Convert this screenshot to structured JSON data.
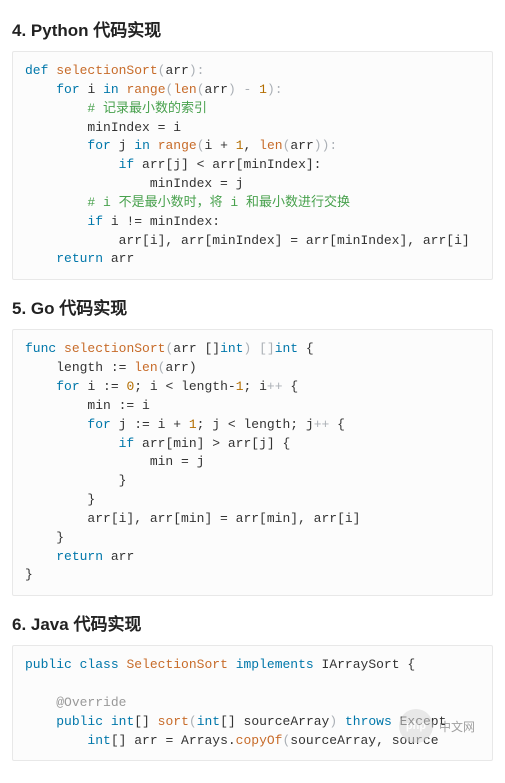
{
  "sections": {
    "s4": {
      "title": "4. Python 代码实现"
    },
    "s5": {
      "title": "5. Go 代码实现"
    },
    "s6": {
      "title": "6. Java 代码实现"
    }
  },
  "watermark": {
    "badge": "php",
    "text": "中文网"
  },
  "code": {
    "python": {
      "l1": {
        "kw_def": "def",
        "sp": " ",
        "fn": "selectionSort",
        "op1": "(",
        "p1": "arr",
        "op2": "):"
      },
      "l2": {
        "ind": "    ",
        "kw_for": "for",
        "sp1": " ",
        "v": "i",
        "sp2": " ",
        "kw_in": "in",
        "sp3": " ",
        "fn": "range",
        "op1": "(",
        "fn2": "len",
        "op2": "(",
        "a": "arr",
        "op3": ") - ",
        "n": "1",
        "op4": "):"
      },
      "l3": {
        "ind": "        ",
        "c": "# 记录最小数的索引"
      },
      "l4": {
        "ind": "        ",
        "a": "minIndex = i"
      },
      "l5": {
        "ind": "        ",
        "kw_for": "for",
        "sp1": " ",
        "v": "j",
        "sp2": " ",
        "kw_in": "in",
        "sp3": " ",
        "fn": "range",
        "op1": "(",
        "a": "i + ",
        "n": "1",
        "mid": ", ",
        "fn2": "len",
        "op2": "(",
        "b": "arr",
        "op3": ")):"
      },
      "l6": {
        "ind": "            ",
        "kw_if": "if",
        "sp": " ",
        "a": "arr[j] < arr[minIndex]:"
      },
      "l7": {
        "ind": "                ",
        "a": "minIndex = j"
      },
      "l8": {
        "ind": "        ",
        "c": "# i 不是最小数时，将 i 和最小数进行交换"
      },
      "l9": {
        "ind": "        ",
        "kw_if": "if",
        "sp": " ",
        "a": "i != minIndex:"
      },
      "l10": {
        "ind": "            ",
        "a": "arr[i], arr[minIndex] = arr[minIndex], arr[i]"
      },
      "l11": {
        "ind": "    ",
        "kw": "return",
        "sp": " ",
        "a": "arr"
      }
    },
    "go": {
      "l1": {
        "kw": "func",
        "sp": " ",
        "fn": "selectionSort",
        "op1": "(",
        "p": "arr []",
        "ty": "int",
        "op2": ") []",
        "ty2": "int",
        "op3": " {"
      },
      "l2": {
        "ind": "    ",
        "a": "length := ",
        "fn": "len",
        "op": "(",
        "b": "arr)"
      },
      "l3": {
        "ind": "    ",
        "kw": "for",
        "sp": " ",
        "a": "i := ",
        "n0": "0",
        "b": "; i < length-",
        "n1": "1",
        "c": "; i",
        "op": "++",
        "d": " {"
      },
      "l4": {
        "ind": "        ",
        "a": "min := i"
      },
      "l5": {
        "ind": "        ",
        "kw": "for",
        "sp": " ",
        "a": "j := i + ",
        "n": "1",
        "b": "; j < length; j",
        "op": "++",
        "c": " {"
      },
      "l6": {
        "ind": "            ",
        "kw": "if",
        "sp": " ",
        "a": "arr[min] > arr[j] {"
      },
      "l7": {
        "ind": "                ",
        "a": "min = j"
      },
      "l8": {
        "ind": "            ",
        "a": "}"
      },
      "l9": {
        "ind": "        ",
        "a": "}"
      },
      "l10": {
        "ind": "        ",
        "a": "arr[i], arr[min] = arr[min], arr[i]"
      },
      "l11": {
        "ind": "    ",
        "a": "}"
      },
      "l12": {
        "ind": "    ",
        "kw": "return",
        "sp": " ",
        "a": "arr"
      },
      "l13": {
        "a": "}"
      }
    },
    "java": {
      "l1": {
        "kw1": "public",
        "sp1": " ",
        "kw2": "class",
        "sp2": " ",
        "cls": "SelectionSort",
        "sp3": " ",
        "kw3": "implements",
        "sp4": " ",
        "ifc": "IArraySort",
        "op": " {"
      },
      "l2": {
        "a": ""
      },
      "l3": {
        "ind": "    ",
        "ann": "@Override"
      },
      "l4": {
        "ind": "    ",
        "kw1": "public",
        "sp1": " ",
        "ty": "int",
        "arr": "[]",
        "sp2": " ",
        "fn": "sort",
        "op1": "(",
        "ty2": "int",
        "arr2": "[]",
        "sp3": " ",
        "p": "sourceArray",
        "op2": ") ",
        "kw2": "throws",
        "sp4": " ",
        "ex": "Except"
      },
      "l5": {
        "ind": "        ",
        "ty": "int",
        "arr": "[]",
        "sp": " ",
        "a": "arr = Arrays.",
        "fn": "copyOf",
        "op": "(",
        "b": "sourceArray, source"
      }
    }
  }
}
